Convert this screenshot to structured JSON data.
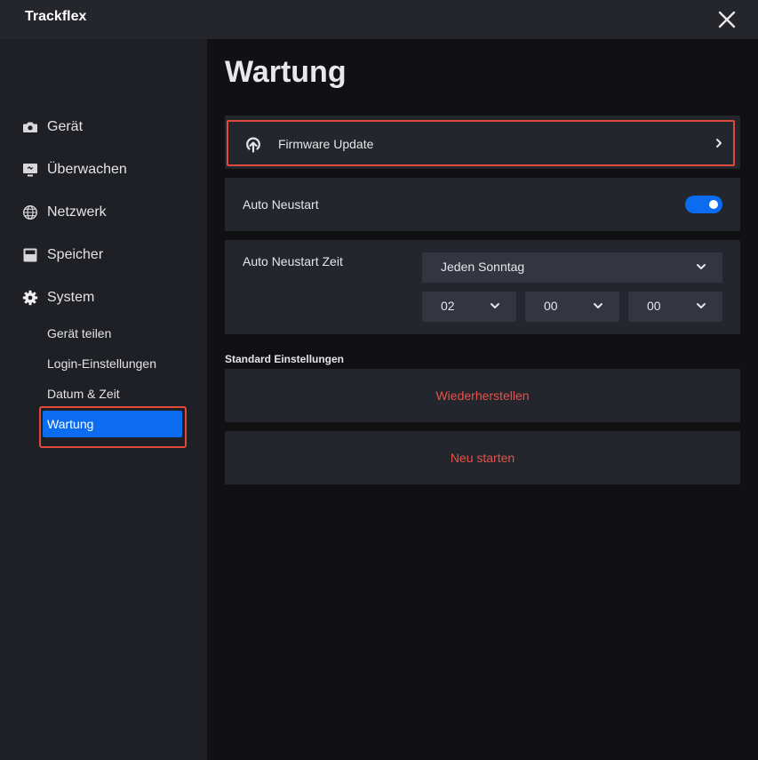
{
  "window": {
    "title": "Trackflex",
    "close_icon": "close-icon"
  },
  "sidebar": {
    "items": [
      {
        "label": "Gerät",
        "icon": "camera-icon"
      },
      {
        "label": "Überwachen",
        "icon": "monitor-icon"
      },
      {
        "label": "Netzwerk",
        "icon": "globe-icon"
      },
      {
        "label": "Speicher",
        "icon": "storage-icon"
      },
      {
        "label": "System",
        "icon": "gear-icon"
      }
    ],
    "system_sub_items": [
      {
        "label": "Gerät teilen"
      },
      {
        "label": "Login-Einstellungen"
      },
      {
        "label": "Datum & Zeit"
      },
      {
        "label": "Wartung",
        "active": true
      }
    ]
  },
  "main": {
    "title": "Wartung",
    "firmware": {
      "label": "Firmware Update",
      "icon": "upload-cloud-icon"
    },
    "auto_restart": {
      "label": "Auto Neustart",
      "enabled": true
    },
    "auto_restart_time": {
      "label": "Auto Neustart Zeit",
      "day": "Jeden Sonntag",
      "hour": "02",
      "minute": "00",
      "second": "00"
    },
    "defaults": {
      "caption": "Standard Einstellungen",
      "restore_label": "Wiederherstellen",
      "reboot_label": "Neu starten"
    }
  },
  "colors": {
    "accent": "#0c6cf0",
    "highlight_frame": "#e14a3a",
    "danger_text": "#e5524a",
    "card_bg": "#24262d",
    "sidebar_bg": "#1e2026"
  }
}
